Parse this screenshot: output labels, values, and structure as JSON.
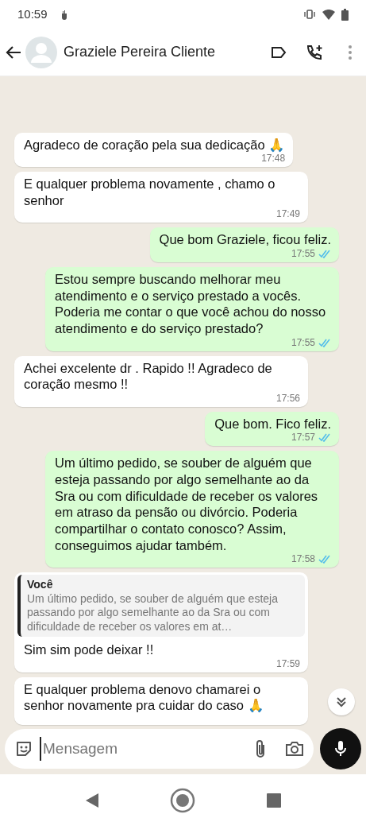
{
  "status_bar": {
    "time": "10:59"
  },
  "header": {
    "contact_name": "Graziele Pereira Cliente"
  },
  "messages": [
    {
      "kind": "in",
      "text": "Agradeco de coração pela sua dedicação 🙏",
      "time": "17:48"
    },
    {
      "kind": "in",
      "text": "E qualquer problema novamente , chamo o senhor",
      "time": "17:49"
    },
    {
      "kind": "out",
      "text": "Que bom Graziele, ficou feliz.",
      "time": "17:55",
      "read": true
    },
    {
      "kind": "out",
      "text": "Estou sempre buscando melhorar meu atendimento e o serviço prestado a vocês. Poderia me contar o que você achou do nosso atendimento e do serviço prestado?",
      "time": "17:55",
      "read": true
    },
    {
      "kind": "in",
      "text": "Achei excelente dr . Rapido !! Agradeco de coração mesmo !!",
      "time": "17:56"
    },
    {
      "kind": "out",
      "text": "Que bom. Fico feliz.",
      "time": "17:57",
      "read": true
    },
    {
      "kind": "out",
      "text": "Um último pedido, se souber de alguém que esteja passando por algo semelhante ao da Sra ou com dificuldade de receber os valores em atraso da pensão ou divórcio. Poderia compartilhar o contato conosco? Assim, conseguimos ajudar também.",
      "time": "17:58",
      "read": true
    },
    {
      "kind": "in",
      "quote": {
        "author": "Você",
        "text": "Um último pedido, se souber de alguém que esteja passando por algo semelhante ao da Sra ou com dificuldade de receber os valores em at…"
      },
      "text": "Sim sim pode deixar !!",
      "time": "17:59"
    },
    {
      "kind": "in",
      "text": "E qualquer problema denovo chamarei o senhor novamente pra cuidar do caso 🙏"
    }
  ],
  "composer": {
    "placeholder": "Mensagem"
  }
}
